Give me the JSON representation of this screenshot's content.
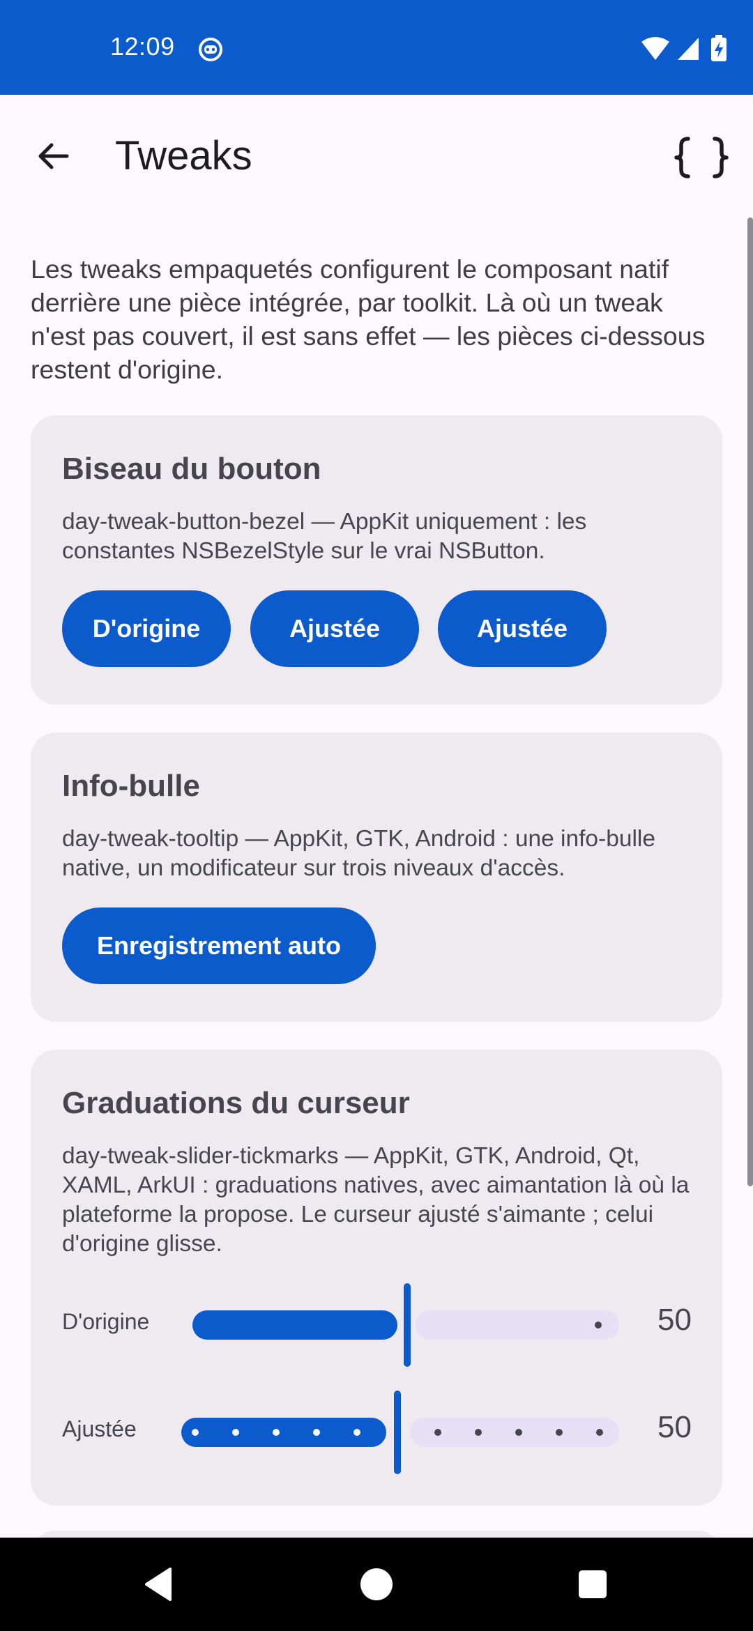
{
  "status_bar": {
    "time": "12:09",
    "notification_icon": "robot-face-icon",
    "icons": [
      "wifi-icon",
      "cellular-signal-icon",
      "battery-charging-icon"
    ],
    "background": "#0b5bcc"
  },
  "app_bar": {
    "back_icon": "arrow-left-icon",
    "title": "Tweaks",
    "action_icon": "curly-braces-icon"
  },
  "intro": "Les tweaks empaquetés configurent le composant natif derrière une pièce intégrée, par toolkit. Là où un tweak n'est pas couvert, il est sans effet — les pièces ci-dessous restent d'origine.",
  "cards": {
    "bezel": {
      "title": "Biseau du bouton",
      "description": "day-tweak-button-bezel — AppKit uniquement : les constantes NSBezelStyle sur le vrai NSButton.",
      "buttons": [
        "D'origine",
        "Ajustée",
        "Ajustée"
      ]
    },
    "tooltip": {
      "title": "Info-bulle",
      "description": "day-tweak-tooltip — AppKit, GTK, Android : une info-bulle native, un modificateur sur trois niveaux d'accès.",
      "button": "Enregistrement auto"
    },
    "slider": {
      "title": "Graduations du curseur",
      "description": "day-tweak-slider-tickmarks — AppKit, GTK, Android, Qt, XAML, ArkUI : graduations natives, avec aimantation là où la plateforme la propose. Le curseur ajusté s'aimante ; celui d'origine glisse.",
      "rows": [
        {
          "label": "D'origine",
          "value": "50",
          "fraction": 0.5,
          "tick_marks": 0
        },
        {
          "label": "Ajustée",
          "value": "50",
          "fraction": 0.5,
          "tick_marks": 11
        }
      ]
    }
  },
  "colors": {
    "accent": "#0b5bcc",
    "track_inactive": "#e6dff5",
    "card_bg": "#efeaf0",
    "page_bg": "#fdf7fe"
  },
  "nav_bar": {
    "buttons": [
      "back-triangle-icon",
      "home-circle-icon",
      "recents-square-icon"
    ]
  }
}
